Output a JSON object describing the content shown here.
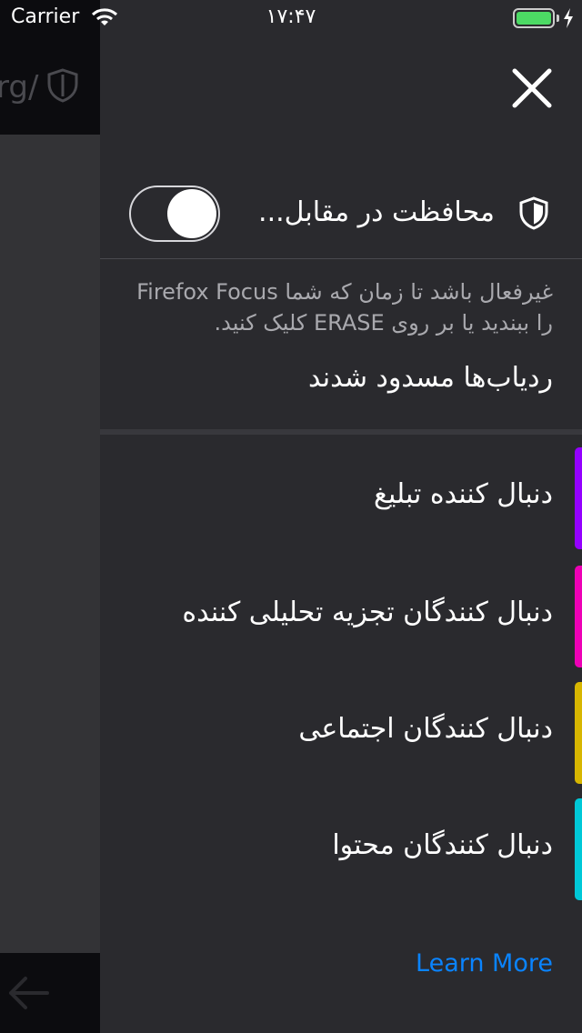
{
  "status_bar": {
    "carrier": "Carrier",
    "time": "۱۷:۴۷"
  },
  "background": {
    "url_fragment": "rg/"
  },
  "panel": {
    "protection_label": "محافظت در مقابل...",
    "protection_enabled": true,
    "description": "غیرفعال باشد تا زمان که شما Firefox Focus را ببندید یا بر روی ERASE کلیک کنید.",
    "trackers_blocked_label": "ردیاب‌ها مسدود شدند",
    "trackers": [
      {
        "label": "دنبال کننده تبلیغ",
        "color": "#9400ff"
      },
      {
        "label": "دنبال کنندگان تجزیه تحلیلی کننده",
        "color": "#ed00b5"
      },
      {
        "label": "دنبال کنندگان اجتماعی",
        "color": "#d7b600"
      },
      {
        "label": "دنبال کنندگان محتوا",
        "color": "#00c8d7"
      }
    ],
    "learn_more": "Learn More"
  },
  "colors": {
    "accent": "#0a84ff",
    "toggle_knob": "#ffffff"
  }
}
